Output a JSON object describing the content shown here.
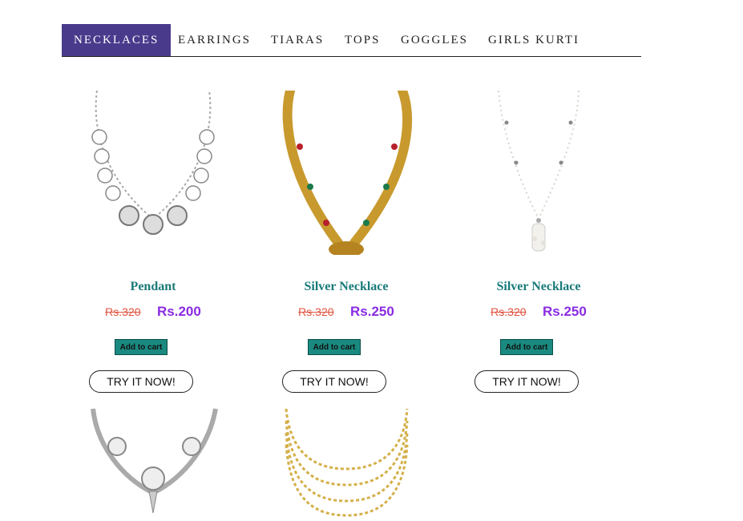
{
  "tabs": [
    "NECKLACES",
    "EARRINGS",
    "TIARAS",
    "TOPS",
    "GOGGLES",
    "GIRLS KURTI"
  ],
  "active_tab": "NECKLACES",
  "products": [
    {
      "name": "Pendant",
      "old_price": "Rs.320",
      "new_price": "Rs.200",
      "cart_label": "Add to cart",
      "try_label": "TRY IT NOW!",
      "image": "silver-coin-necklace"
    },
    {
      "name": "Silver Necklace",
      "old_price": "Rs.320",
      "new_price": "Rs.250",
      "cart_label": "Add to cart",
      "try_label": "TRY IT NOW!",
      "image": "gold-long-necklace"
    },
    {
      "name": "Silver Necklace",
      "old_price": "Rs.320",
      "new_price": "Rs.250",
      "cart_label": "Add to cart",
      "try_label": "TRY IT NOW!",
      "image": "pearl-drop-necklace"
    }
  ],
  "more_products": [
    {
      "image": "diamond-silver-necklace"
    },
    {
      "image": "gold-layered-necklace"
    }
  ],
  "colors": {
    "active_tab_bg": "#4a3a8c",
    "product_name": "#1a7a7a",
    "old_price": "#e0523f",
    "new_price": "#8a2be2",
    "cart_button": "#1a8a80"
  }
}
